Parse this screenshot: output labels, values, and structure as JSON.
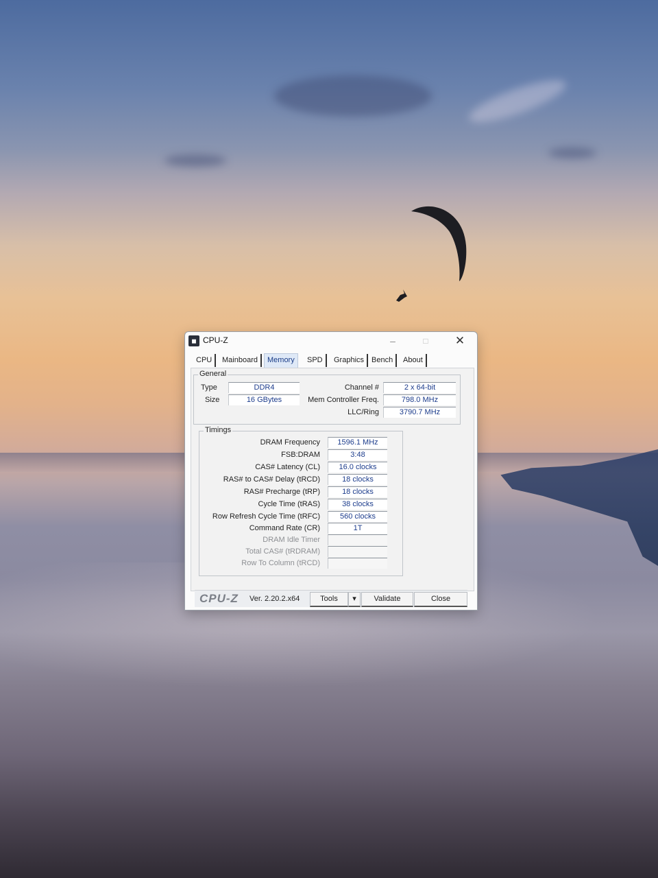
{
  "window": {
    "title": "CPU-Z"
  },
  "tabs": [
    "CPU",
    "Mainboard",
    "Memory",
    "SPD",
    "Graphics",
    "Bench",
    "About"
  ],
  "active_tab": "Memory",
  "general": {
    "title": "General",
    "type_label": "Type",
    "type_value": "DDR4",
    "size_label": "Size",
    "size_value": "16 GBytes",
    "channel_label": "Channel #",
    "channel_value": "2 x 64-bit",
    "mcf_label": "Mem Controller Freq.",
    "mcf_value": "798.0 MHz",
    "llc_label": "LLC/Ring",
    "llc_value": "3790.7 MHz"
  },
  "timings": {
    "title": "Timings",
    "rows": [
      {
        "label": "DRAM Frequency",
        "value": "1596.1 MHz"
      },
      {
        "label": "FSB:DRAM",
        "value": "3:48"
      },
      {
        "label": "CAS# Latency (CL)",
        "value": "16.0 clocks"
      },
      {
        "label": "RAS# to CAS# Delay (tRCD)",
        "value": "18 clocks"
      },
      {
        "label": "RAS# Precharge (tRP)",
        "value": "18 clocks"
      },
      {
        "label": "Cycle Time (tRAS)",
        "value": "38 clocks"
      },
      {
        "label": "Row Refresh Cycle Time (tRFC)",
        "value": "560 clocks"
      },
      {
        "label": "Command Rate (CR)",
        "value": "1T"
      },
      {
        "label": "DRAM Idle Timer",
        "value": ""
      },
      {
        "label": "Total CAS# (tRDRAM)",
        "value": ""
      },
      {
        "label": "Row To Column (tRCD)",
        "value": ""
      }
    ]
  },
  "footer": {
    "logo": "CPU-Z",
    "version": "Ver. 2.20.2.x64",
    "tools": "Tools",
    "validate": "Validate",
    "close": "Close"
  }
}
